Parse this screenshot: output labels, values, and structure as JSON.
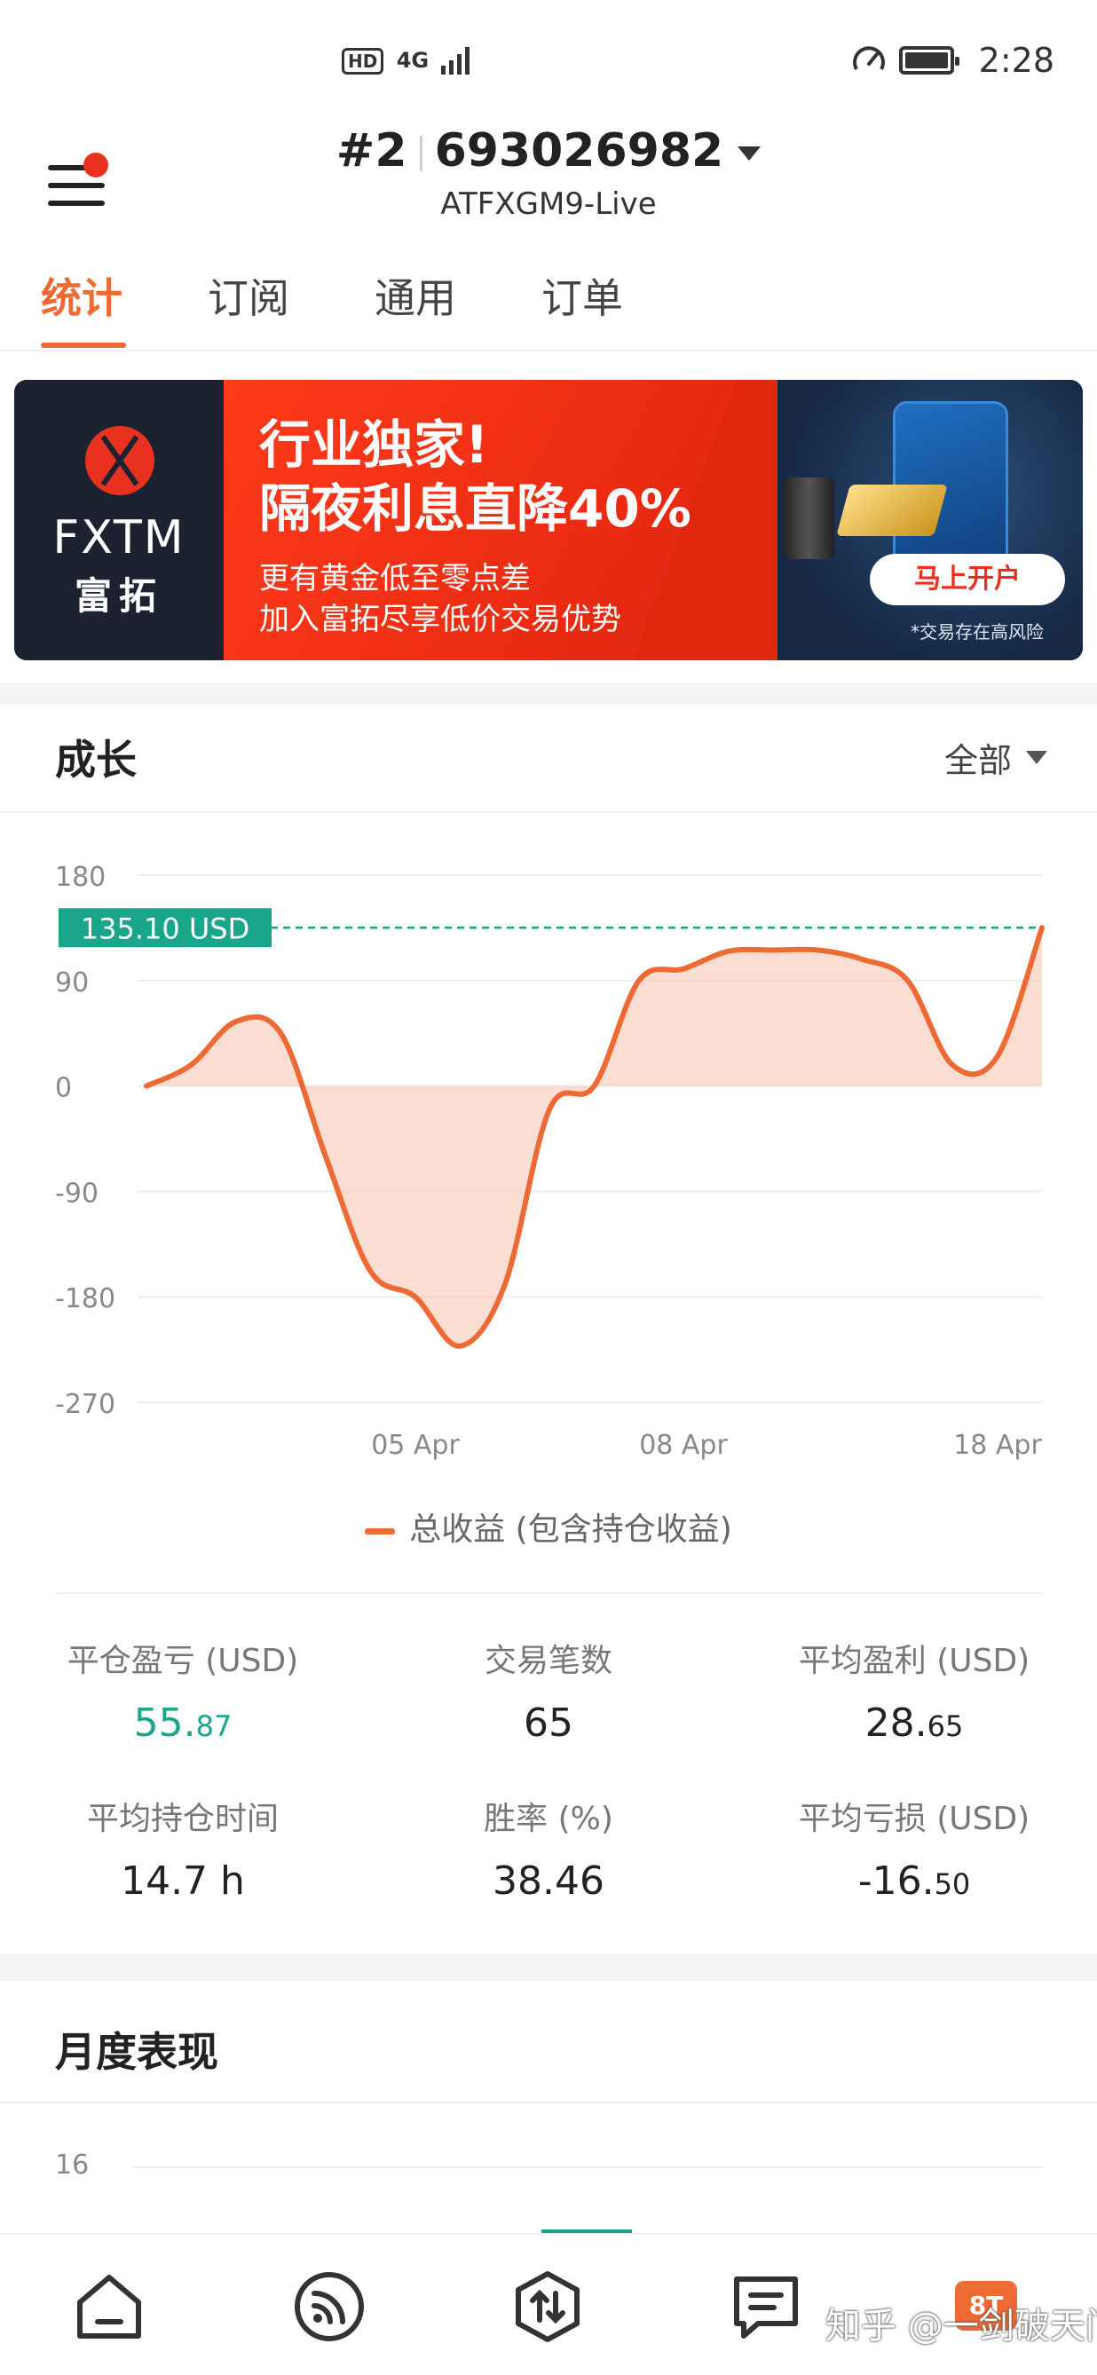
{
  "status_bar": {
    "network": "4G",
    "network_badge": "HD",
    "time": "2:28"
  },
  "header": {
    "account_index": "#2",
    "account_number": "693026982",
    "server": "ATFXGM9-Live"
  },
  "tabs": [
    {
      "label": "统计",
      "active": true
    },
    {
      "label": "订阅",
      "active": false
    },
    {
      "label": "通用",
      "active": false
    },
    {
      "label": "订单",
      "active": false
    }
  ],
  "banner": {
    "logo_text": "FXTM",
    "logo_cn": "富拓",
    "headline1": "行业独家!",
    "headline2": "隔夜利息直降40%",
    "sub1": "更有黄金低至零点差",
    "sub2": "加入富拓尽享低价交易优势",
    "cta": "马上开户",
    "risk": "*交易存在高风险"
  },
  "growth": {
    "title": "成长",
    "range": "全部",
    "legend": "总收益 (包含持仓收益)"
  },
  "chart_data": {
    "type": "area",
    "y_ticks": [
      "180",
      "90",
      "0",
      "-90",
      "-180",
      "-270"
    ],
    "x_ticks": [
      "05 Apr",
      "08 Apr",
      "18 Apr"
    ],
    "ylim": [
      -270,
      180
    ],
    "current_label": "135.10 USD",
    "current_value": 135.1,
    "series": [
      {
        "values": [
          0,
          18,
          55,
          45,
          -60,
          -158,
          -180,
          -222,
          -170,
          -20,
          0,
          90,
          100,
          115,
          116,
          116,
          108,
          90,
          18,
          25,
          135.1
        ]
      }
    ],
    "colors": {
      "line": "#ee6a34",
      "fill": "#f7b49a",
      "marker": "#1aa68a"
    }
  },
  "stats": [
    {
      "label": "平仓盈亏 (USD)",
      "value_main": "55.",
      "value_small": "87",
      "positive": true
    },
    {
      "label": "交易笔数",
      "value_main": "65",
      "value_small": ""
    },
    {
      "label": "平均盈利 (USD)",
      "value_main": "28.",
      "value_small": "65"
    },
    {
      "label": "平均持仓时间",
      "value_main": "14.7 h",
      "value_small": ""
    },
    {
      "label": "胜率 (%)",
      "value_main": "38.46",
      "value_small": ""
    },
    {
      "label": "平均亏损 (USD)",
      "value_main": "-16.",
      "value_small": "50"
    }
  ],
  "monthly": {
    "title": "月度表现",
    "y_tick": "16"
  },
  "bottom_nav": {
    "items": [
      "home-icon",
      "signals-icon",
      "trade-icon",
      "notes-icon"
    ],
    "badge": "8T",
    "watermark": "知乎 @一剑破天门"
  },
  "colors": {
    "accent": "#ee6a34",
    "positive": "#1aa68a",
    "banner_red": "#e8321f"
  }
}
